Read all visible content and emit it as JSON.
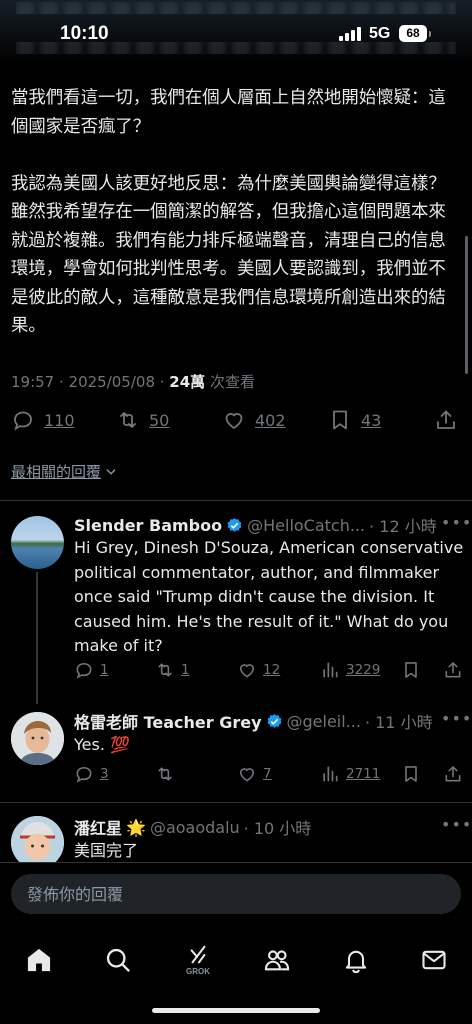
{
  "status_bar": {
    "time": "10:10",
    "network": "5G",
    "battery": "68"
  },
  "tweet": {
    "paragraphs": [
      "當我們看這一切，我們在個人層面上自然地開始懷疑：這個國家是否瘋了？",
      "我認為美國人該更好地反思：為什麼美國輿論變得這樣？雖然我希望存在一個簡潔的解答，但我擔心這個問題本來就過於複雜。我們有能力排斥極端聲音，清理自己的信息環境，學會如何批判性思考。美國人要認識到，我們並不是彼此的敵人，這種敵意是我們信息環境所創造出來的結果。"
    ],
    "timestamp": "19:57 · 2025/05/08 · ",
    "views": "24萬",
    "views_suffix": " 次查看",
    "replies": "110",
    "retweets": "50",
    "likes": "402",
    "bookmarks": "43"
  },
  "sort_label": "最相關的回覆",
  "replies": [
    {
      "name": "Slender Bamboo",
      "handle": "@HelloCatch...",
      "time": "· 12 小時",
      "verified": true,
      "text": "Hi Grey, Dinesh D'Souza, American conservative political commentator, author, and filmmaker once said \"Trump didn't cause the division. It caused him. He's the result of it.\" What do you make of it?",
      "replies": "1",
      "retweets": "1",
      "likes": "12",
      "views": "3229"
    },
    {
      "name": "格雷老師 Teacher Grey",
      "handle": "@geleil...",
      "time": "· 11 小時",
      "verified": true,
      "text": "Yes. 💯",
      "replies": "3",
      "retweets": "",
      "likes": "7",
      "views": "2711"
    },
    {
      "name": "潘红星",
      "name_emoji": "🌟",
      "handle": "@aoaodalu",
      "time": "· 10 小時",
      "verified": false,
      "text": "美国完了"
    }
  ],
  "compose": {
    "placeholder": "發佈你的回覆"
  },
  "tabbar": {
    "grok_label": "GROK"
  },
  "colors": {
    "accent": "#1d9bf0",
    "muted": "#71767b",
    "text": "#e7e9ea",
    "background": "#000000",
    "hundred": "#f4212e"
  },
  "icons": [
    "home-icon",
    "search-icon",
    "grok-icon",
    "communities-icon",
    "notifications-icon",
    "messages-icon"
  ]
}
